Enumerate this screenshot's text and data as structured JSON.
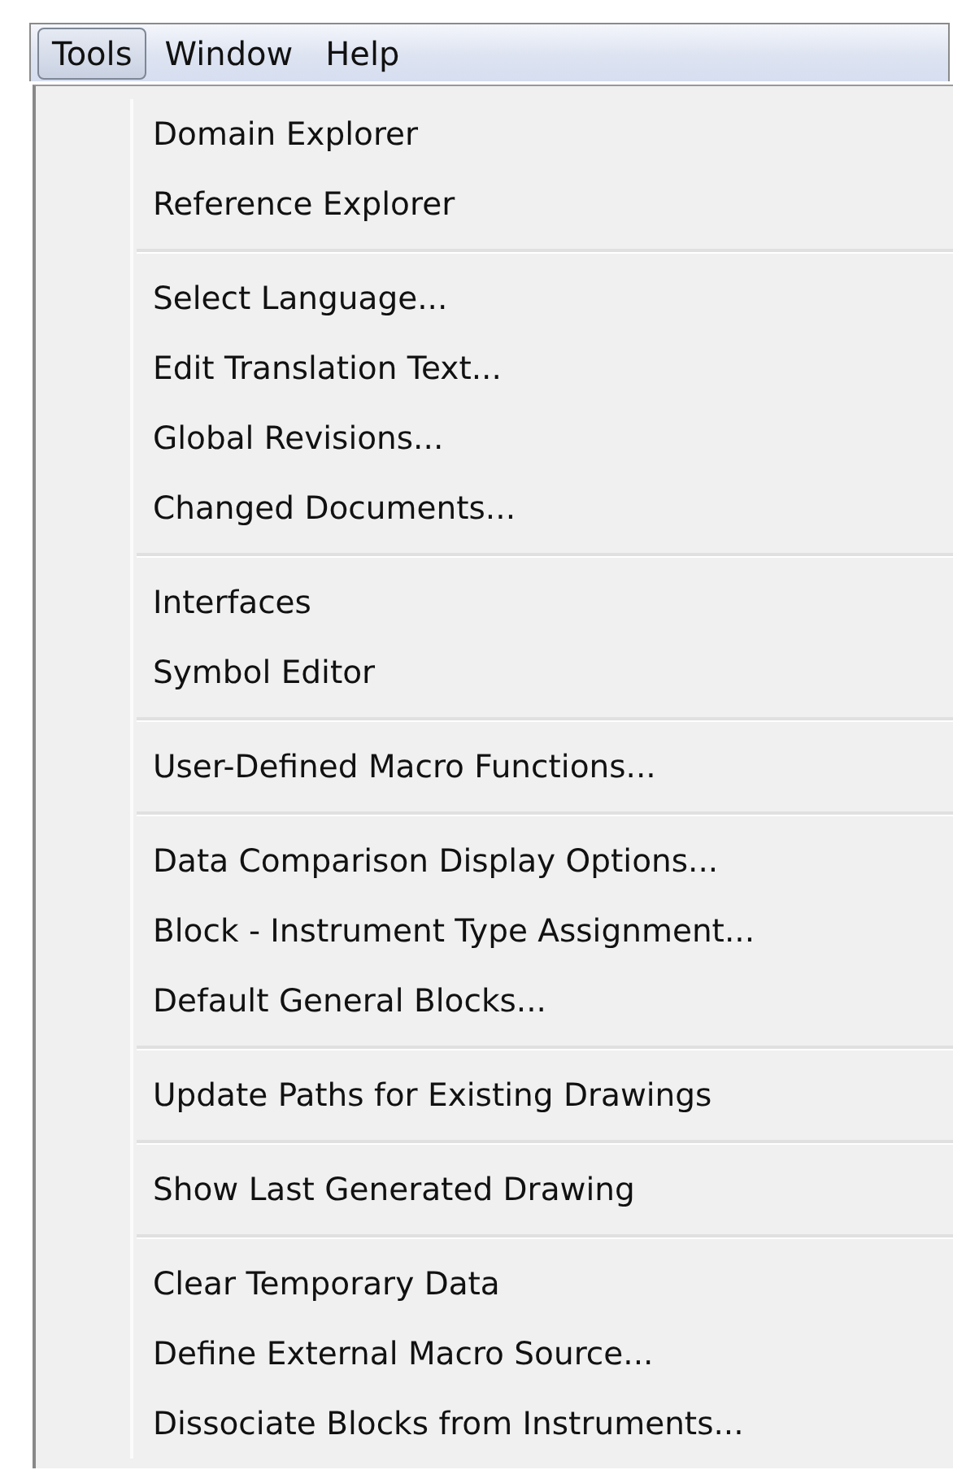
{
  "menubar": [
    {
      "label": "Tools",
      "selected": true
    },
    {
      "label": "Window",
      "selected": false
    },
    {
      "label": "Help",
      "selected": false
    }
  ],
  "menu": {
    "groups": [
      {
        "items": [
          "Domain Explorer",
          "Reference Explorer"
        ]
      },
      {
        "items": [
          "Select Language...",
          "Edit Translation Text...",
          "Global Revisions...",
          "Changed Documents..."
        ]
      },
      {
        "items": [
          "Interfaces",
          "Symbol Editor"
        ]
      },
      {
        "items": [
          "User-Defined Macro Functions..."
        ]
      },
      {
        "items": [
          "Data Comparison Display Options...",
          "Block - Instrument Type Assignment...",
          "Default General Blocks..."
        ]
      },
      {
        "items": [
          "Update Paths for Existing Drawings"
        ]
      },
      {
        "items": [
          "Show Last Generated Drawing"
        ]
      },
      {
        "items": [
          "Clear Temporary Data",
          "Define External Macro Source...",
          "Dissociate Blocks from Instruments..."
        ]
      }
    ]
  }
}
